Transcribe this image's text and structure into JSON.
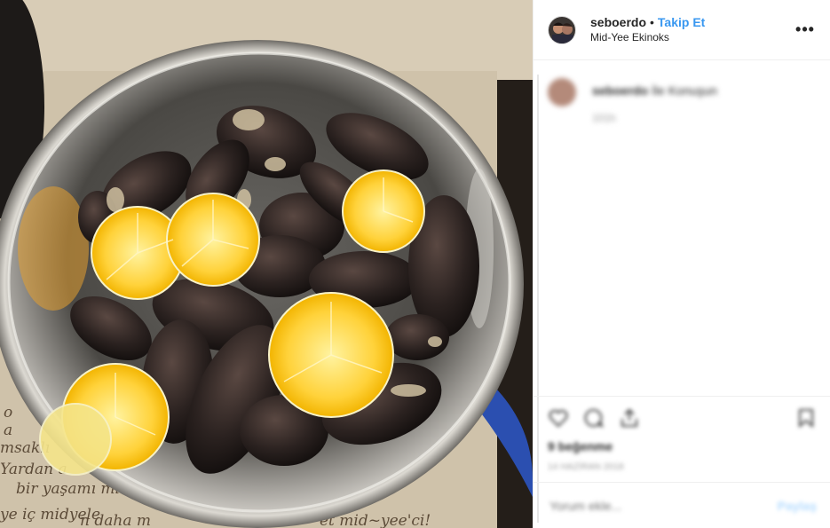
{
  "header": {
    "username": "seboerdo",
    "separator": "•",
    "follow_label": "Takip Et",
    "location": "Mid-Yee Ekinoks",
    "more_label": "•••"
  },
  "comments": {
    "items": [
      {
        "username": "seboerdo",
        "text": "İle Konuşun",
        "time": "101h"
      }
    ]
  },
  "actions": {
    "icons": [
      "heart-icon",
      "comment-icon",
      "share-icon",
      "bookmark-icon"
    ],
    "likes": "9 beğenme",
    "timestamp": "14 HAZİRAN 2018"
  },
  "add_comment": {
    "placeholder": "Yorum ekle...",
    "post_label": "Paylaş"
  },
  "photo": {
    "placemat_text_1": "bir yaşamı midyeler",
    "placemat_text_2": "Yardan a",
    "placemat_text_3": "msaklı",
    "placemat_text_4": "ye iç midyele",
    "placemat_text_5": "n daha m",
    "placemat_text_6": "et mid~yee'ci!",
    "placemat_text_7": "o",
    "placemat_text_8": "a"
  },
  "colors": {
    "accent": "#3897f0",
    "text": "#262626",
    "muted": "#999999",
    "border": "#efefef"
  }
}
